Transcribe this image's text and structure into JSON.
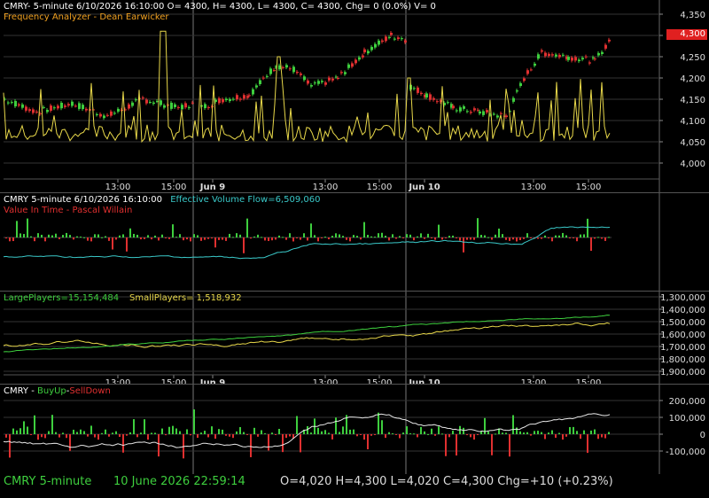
{
  "panel1": {
    "header": "CMRY- 5-minute 6/10/2026 16:10:00 O= 4300, H= 4300, L= 4300, C= 4300, Chg= 0 (0.0%) V= 0",
    "indicator": "Frequency Analyzer - Dean Earwicker",
    "price_label": "4,300",
    "y_ticks": [
      "4,350",
      "4,300",
      "4,250",
      "4,200",
      "4,150",
      "4,100",
      "4,050",
      "4,000"
    ],
    "time_labels": [
      "13:00",
      "15:00",
      "Jun 9",
      "13:00",
      "15:00",
      "Jun 10",
      "13:00",
      "15:00"
    ]
  },
  "panel2": {
    "header_a": "CMRY 5-minute  6/10/2026 16:10:00",
    "header_b": "Effective Volume Flow=6,509,060",
    "indicator": "Value In Time - Pascal Willain"
  },
  "panel3": {
    "large": "LargePlayers=15,154,484",
    "small": "SmallPlayers= 1,518,932",
    "y_ticks": [
      "1,300,000",
      "1,400,000",
      "1,500,000",
      "1,600,000",
      "1,700,000",
      "1,800,000",
      "1,900,000"
    ],
    "time_labels": [
      "13:00",
      "15:00",
      "Jun 9",
      "13:00",
      "15:00",
      "Jun 10",
      "13:00",
      "15:00"
    ]
  },
  "panel4": {
    "prefix": "CMRY - ",
    "buy": "BuyUp",
    "dash": "-",
    "sell": "SellDown",
    "y_ticks": [
      "200,000",
      "100,000",
      "0",
      "-100,000"
    ]
  },
  "status": {
    "symbol": "CMRY  5-minute",
    "date": "10 June 2026 22:59:14",
    "ohlc": "O=4,020  H=4,300  L=4,020  C=4,300  Chg=+10 (+0.23%)"
  },
  "colors": {
    "up": "#3ecf3e",
    "down": "#e03030",
    "yellow": "#e8d84a",
    "white": "#e8e8e8",
    "cyan": "#3ac9c9",
    "orange": "#f0a020",
    "grid": "#333333"
  }
}
